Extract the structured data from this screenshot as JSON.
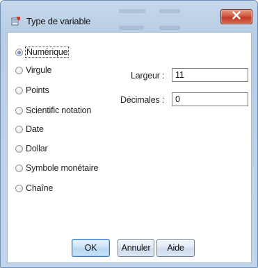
{
  "window": {
    "title": "Type de variable",
    "close_glyph": "X"
  },
  "variable_types": [
    {
      "label": "Numérique",
      "checked": true
    },
    {
      "label": "Virgule",
      "checked": false
    },
    {
      "label": "Points",
      "checked": false
    },
    {
      "label": "Scientific notation",
      "checked": false
    },
    {
      "label": "Date",
      "checked": false
    },
    {
      "label": "Dollar",
      "checked": false
    },
    {
      "label": "Symbole monétaire",
      "checked": false
    },
    {
      "label": "Chaîne",
      "checked": false
    }
  ],
  "fields": {
    "width_label": "Largeur :",
    "width_value": "11",
    "decimals_label": "Décimales :",
    "decimals_value": "0"
  },
  "buttons": {
    "ok": "OK",
    "cancel": "Annuler",
    "help": "Aide"
  },
  "colors": {
    "accent": "#3d7bbf",
    "close_button": "#c0392b"
  },
  "icons": {
    "title": "spss-variable-icon",
    "close": "close-icon"
  }
}
